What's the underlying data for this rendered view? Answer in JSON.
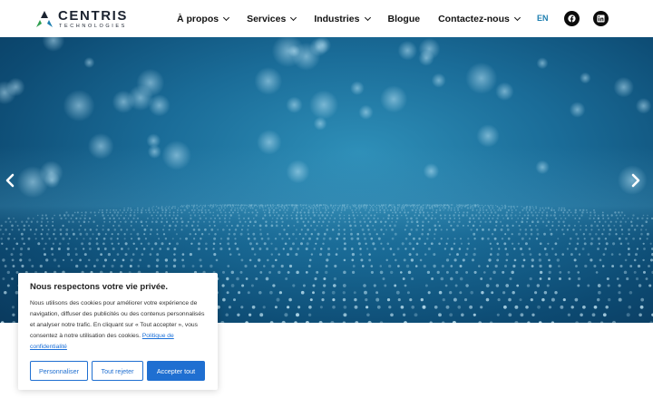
{
  "header": {
    "logo": {
      "name": "CENTRIS",
      "sub": "TECHNOLOGIES"
    },
    "nav": [
      {
        "label": "À propos",
        "has_dropdown": true
      },
      {
        "label": "Services",
        "has_dropdown": true
      },
      {
        "label": "Industries",
        "has_dropdown": true
      },
      {
        "label": "Blogue",
        "has_dropdown": false
      },
      {
        "label": "Contactez-nous",
        "has_dropdown": true
      }
    ],
    "lang": "EN",
    "social": [
      "facebook-icon",
      "linkedin-icon"
    ]
  },
  "hero": {
    "prev_icon": "chevron-left-icon",
    "next_icon": "chevron-right-icon"
  },
  "cookie": {
    "title": "Nous respectons votre vie privée.",
    "body": "Nous utilisons des cookies pour améliorer votre expérience de navigation, diffuser des publicités ou des contenus personnalisés et analyser notre trafic. En cliquant sur « Tout accepter », vous consentez à notre utilisation des cookies.",
    "policy_link": "Politique de confidentialité",
    "buttons": {
      "customize": "Personnaliser",
      "reject": "Tout rejeter",
      "accept": "Accepter tout"
    }
  },
  "colors": {
    "accent": "#1f6fd1",
    "lang": "#1e7fb0",
    "hero": "#1a6c98"
  }
}
